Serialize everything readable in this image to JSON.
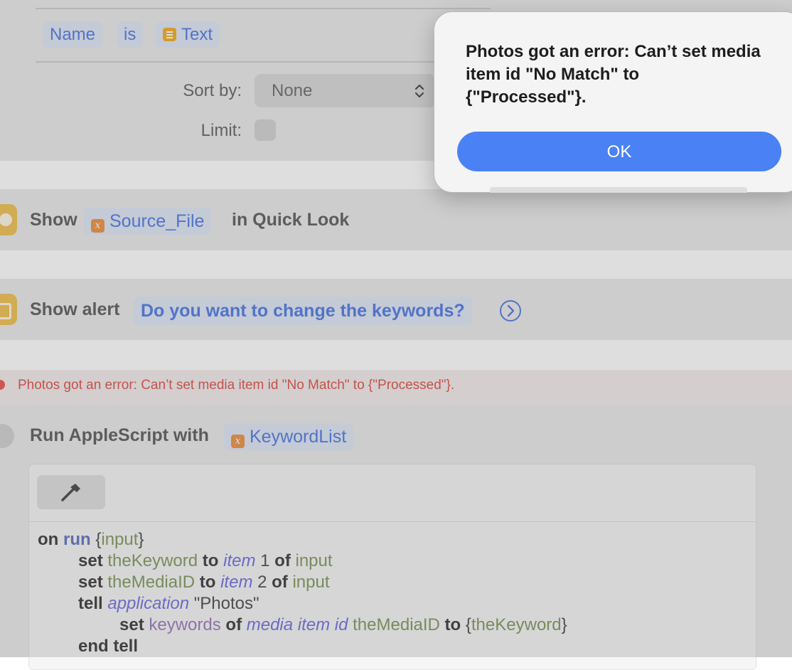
{
  "filter": {
    "field": "Name",
    "operator": "is",
    "value": "Text",
    "sort_label": "Sort by:",
    "sort_value": "None",
    "limit_label": "Limit:"
  },
  "actions": {
    "quicklook": {
      "verb": "Show",
      "variable": "Source_File",
      "suffix": "in Quick Look"
    },
    "alert": {
      "verb": "Show alert",
      "message": "Do you want to change the keywords?"
    },
    "error": {
      "text": "Photos got an error: Can’t set media item id \"No Match\" to {\"Processed\"}."
    },
    "applescript": {
      "label": "Run AppleScript with",
      "variable": "KeywordList"
    }
  },
  "script": {
    "l1": {
      "on": "on",
      "run": "run",
      "params_open": " {",
      "input": "input",
      "params_close": "}"
    },
    "l2": {
      "set": "set",
      "var": "theKeyword",
      "to": "to",
      "item": "item",
      "num": "1",
      "of": "of",
      "input": "input"
    },
    "l3": {
      "set": "set",
      "var": "theMediaID",
      "to": "to",
      "item": "item",
      "num": "2",
      "of": "of",
      "input": "input"
    },
    "l4": {
      "tell": "tell",
      "application": "application",
      "str": "\"Photos\""
    },
    "l5": {
      "set": "set",
      "keywords": "keywords",
      "of": "of",
      "media_item": "media item",
      "id": "id",
      "var": "theMediaID",
      "to": "to",
      "list_open": "{",
      "list_var": "theKeyword",
      "list_close": "}"
    },
    "l6": {
      "end_tell": "end tell"
    }
  },
  "dialog": {
    "message": "Photos got an error: Can’t set media item id \"No Match\" to {\"Processed\"}.",
    "ok_label": "OK"
  },
  "colors": {
    "accent": "#4a82f5",
    "error": "#e16058",
    "token_text": "#5d86e6"
  }
}
